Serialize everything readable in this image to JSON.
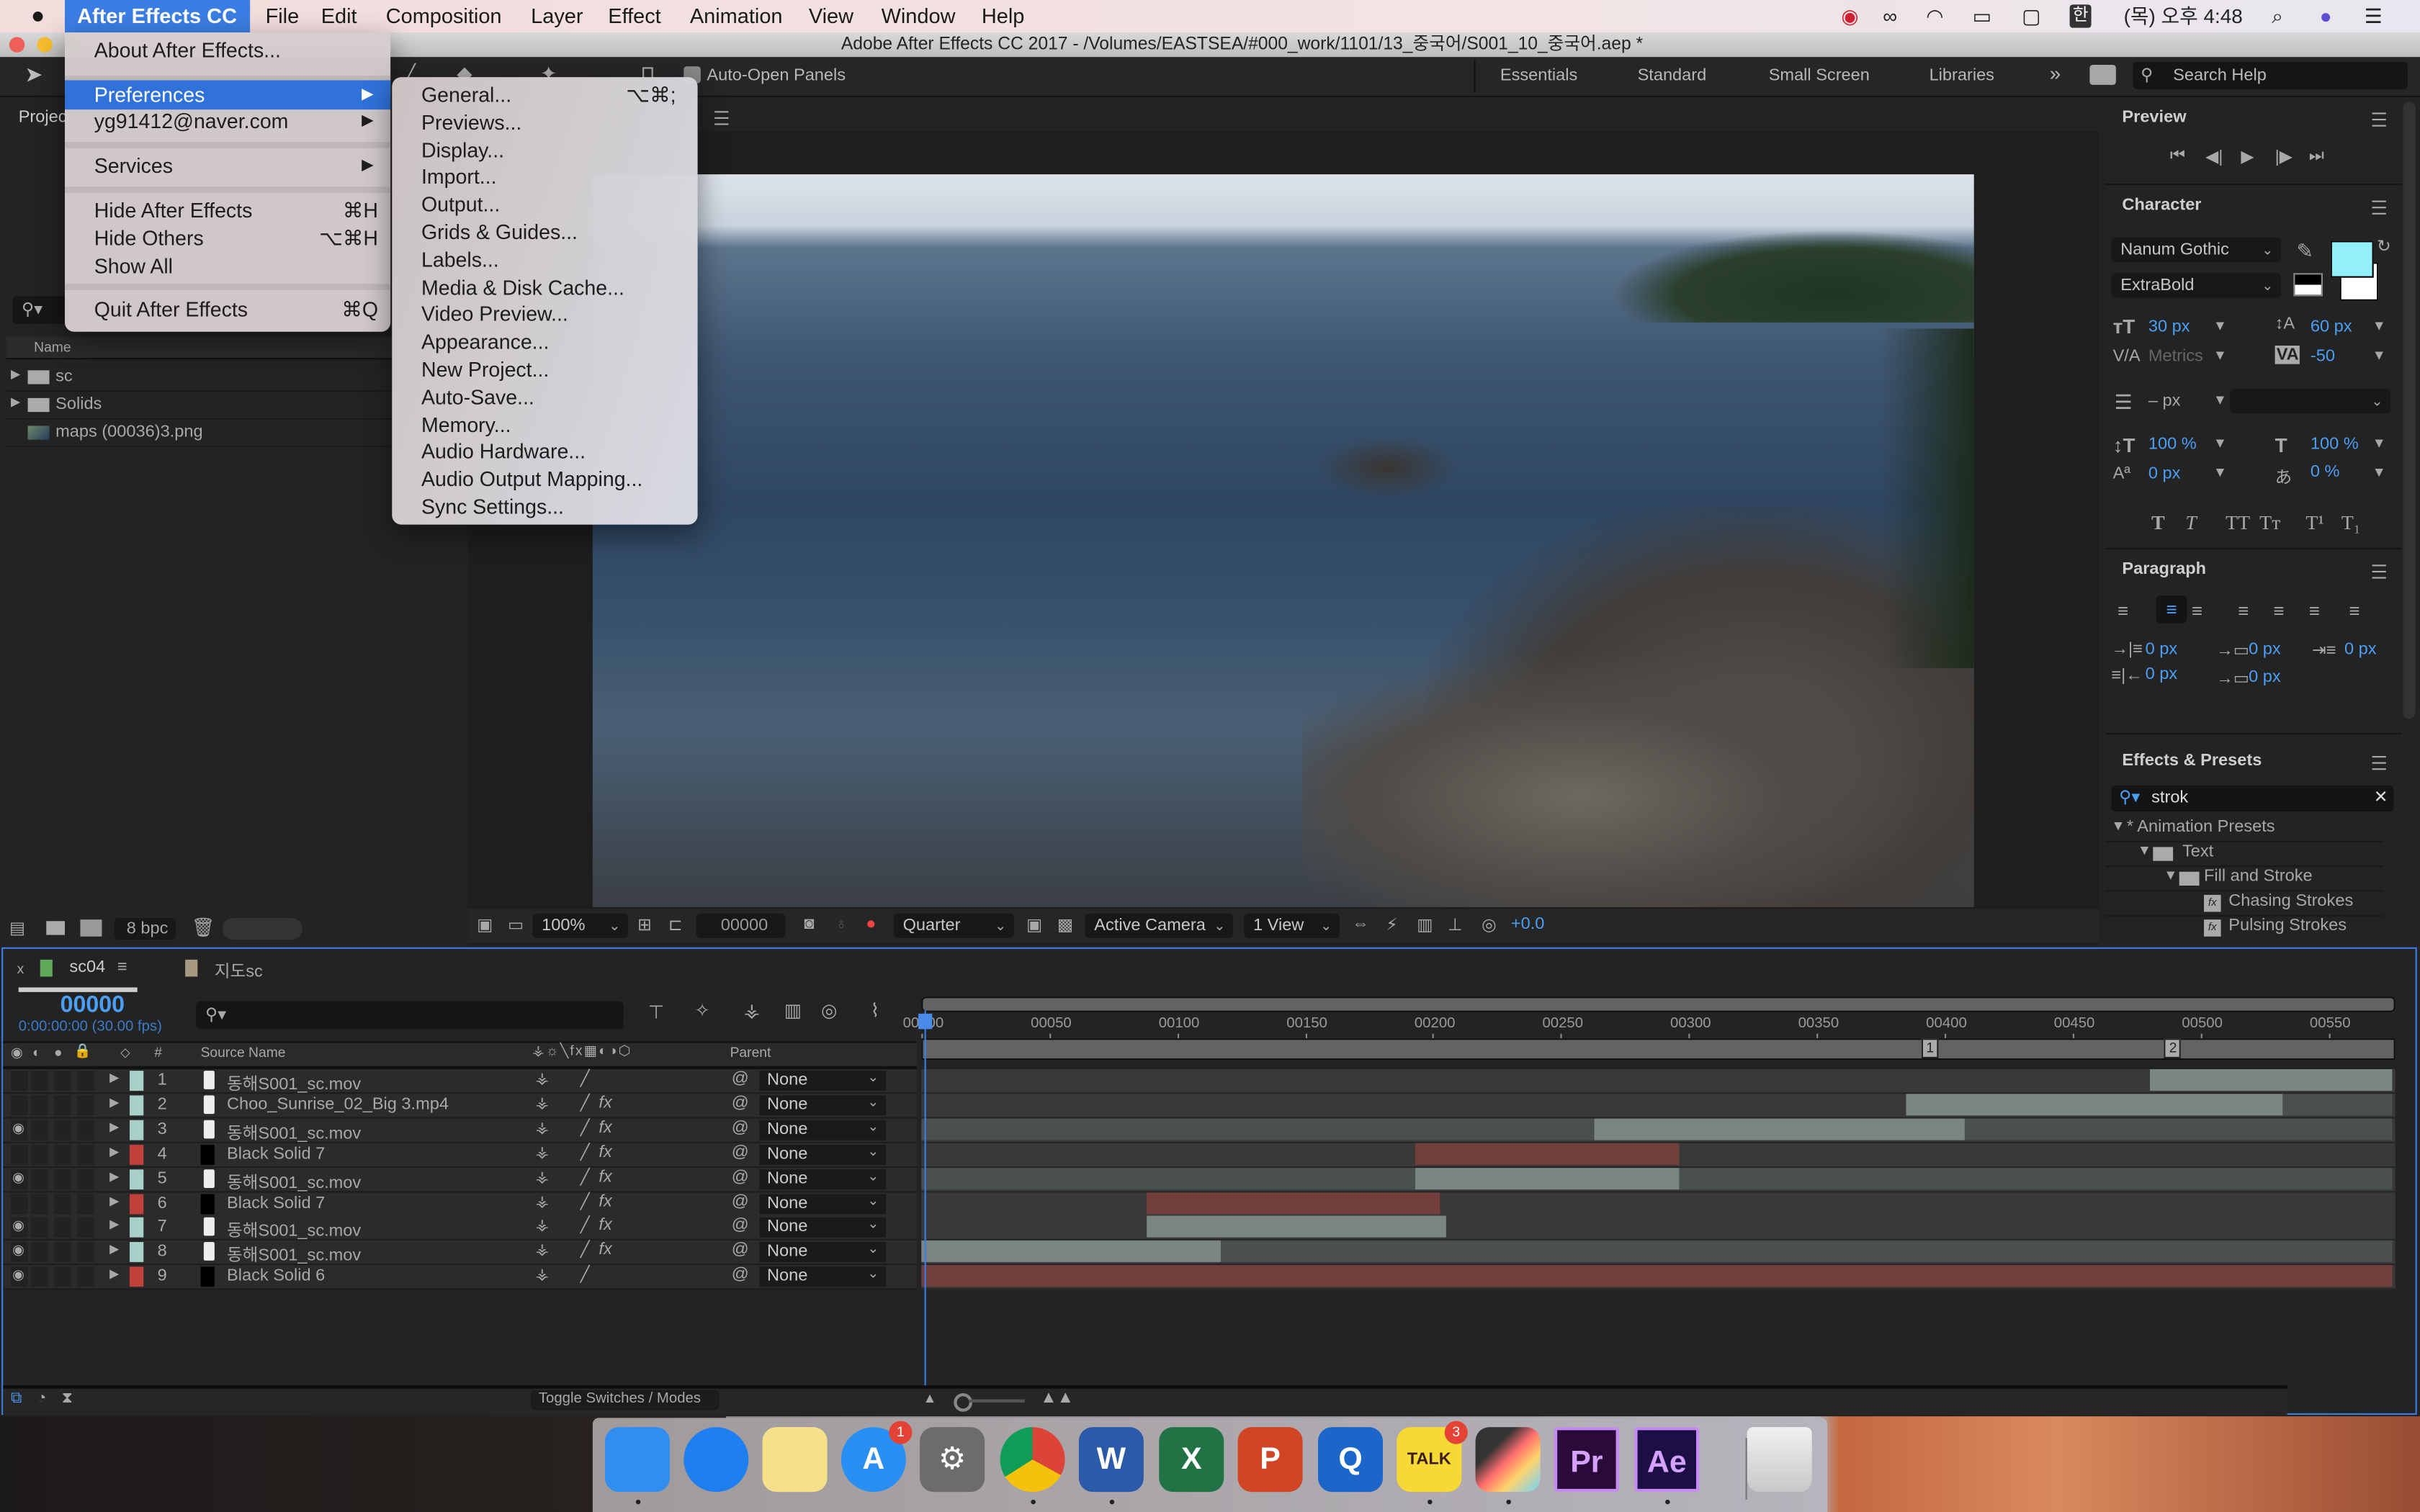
{
  "menubar": {
    "apple": "",
    "items": [
      "After Effects CC",
      "File",
      "Edit",
      "Composition",
      "Layer",
      "Effect",
      "Animation",
      "View",
      "Window",
      "Help"
    ],
    "active_index": 0,
    "input_method": "한",
    "clock": "(목) 오후 4:48"
  },
  "window": {
    "title": "Adobe After Effects CC 2017 - /Volumes/EASTSEA/#000_work/1101/13_중국어/S001_10_중국어.aep *"
  },
  "toolbar": {
    "auto_open_label": "Auto-Open Panels",
    "workspaces": [
      "Essentials",
      "Standard",
      "Small Screen",
      "Libraries"
    ],
    "more": "»",
    "search_placeholder": "Search Help"
  },
  "app_menu": {
    "items": [
      {
        "label": "About After Effects..."
      },
      {
        "label": "Preferences",
        "submenu": true,
        "selected": true
      },
      {
        "label": "yg91412@naver.com",
        "submenu": true
      },
      {
        "label": "Services",
        "submenu": true
      },
      {
        "label": "Hide After Effects",
        "shortcut": "⌘H"
      },
      {
        "label": "Hide Others",
        "shortcut": "⌥⌘H"
      },
      {
        "label": "Show All"
      },
      {
        "label": "Quit After Effects",
        "shortcut": "⌘Q"
      }
    ]
  },
  "prefs_menu": {
    "items": [
      {
        "label": "General...",
        "shortcut": "⌥⌘;"
      },
      {
        "label": "Previews..."
      },
      {
        "label": "Display..."
      },
      {
        "label": "Import..."
      },
      {
        "label": "Output..."
      },
      {
        "label": "Grids & Guides..."
      },
      {
        "label": "Labels..."
      },
      {
        "label": "Media & Disk Cache..."
      },
      {
        "label": "Video Preview..."
      },
      {
        "label": "Appearance..."
      },
      {
        "label": "New Project..."
      },
      {
        "label": "Auto-Save..."
      },
      {
        "label": "Memory..."
      },
      {
        "label": "Audio Hardware..."
      },
      {
        "label": "Audio Output Mapping..."
      },
      {
        "label": "Sync Settings..."
      }
    ]
  },
  "project": {
    "tab": "Projec",
    "column_name": "Name",
    "items": [
      {
        "name": "sc",
        "type": "folder"
      },
      {
        "name": "Solids",
        "type": "folder"
      },
      {
        "name": "maps (00036)3.png",
        "type": "image"
      }
    ],
    "bpc": "8 bpc"
  },
  "viewer": {
    "zoom": "100%",
    "timecode": "00000",
    "resolution": "Quarter",
    "camera": "Active Camera",
    "views": "1 View",
    "exposure": "+0.0"
  },
  "preview_panel": {
    "title": "Preview"
  },
  "character": {
    "title": "Character",
    "font": "Nanum Gothic",
    "style": "ExtraBold",
    "fill_color": "#93f0fb",
    "size": "30 px",
    "leading": "60 px",
    "kerning": "Metrics",
    "tracking": "-50",
    "stroke_width": "– px",
    "vert_scale": "100 %",
    "horiz_scale": "100 %",
    "baseline": "0 px",
    "tsume": "0 %",
    "styles": [
      "T",
      "T",
      "TT",
      "Tт",
      "T¹",
      "T₁"
    ]
  },
  "paragraph": {
    "title": "Paragraph",
    "indent_left": "0 px",
    "indent_first": "0 px",
    "indent_right": "0 px",
    "space_before": "0 px",
    "space_after": "0 px",
    "active_align": 1
  },
  "effects": {
    "title": "Effects & Presets",
    "search_value": "strok",
    "tree": [
      {
        "label": "* Animation Presets",
        "level": 0,
        "type": "group"
      },
      {
        "label": "Text",
        "level": 1,
        "type": "folder"
      },
      {
        "label": "Fill and Stroke",
        "level": 2,
        "type": "folder"
      },
      {
        "label": "Chasing Strokes",
        "level": 3,
        "type": "preset"
      },
      {
        "label": "Pulsing Strokes",
        "level": 3,
        "type": "preset"
      }
    ]
  },
  "timeline": {
    "tabs": [
      {
        "label": "sc04",
        "color": "#5fa85a",
        "active": true
      },
      {
        "label": "지도sc",
        "color": "#a89a80",
        "active": false
      }
    ],
    "timecode": "00000",
    "timecode_sub": "0:00:00:00 (30.00 fps)",
    "headers": {
      "num": "#",
      "source": "Source Name",
      "parent": "Parent"
    },
    "ruler_labels": [
      "00000",
      "00050",
      "00100",
      "00150",
      "00200",
      "00250",
      "00300",
      "00350",
      "00400",
      "00450",
      "00500",
      "00550"
    ],
    "ruler_max": 575,
    "markers": [
      "1",
      "2"
    ],
    "marker_frames": [
      391,
      486
    ],
    "layers": [
      {
        "num": "1",
        "name": "동해S001_sc.mov",
        "label": "#a9cfc9",
        "type": "movie",
        "visible": false,
        "fx": false,
        "parent": "None",
        "in": 480,
        "out": 575
      },
      {
        "num": "2",
        "name": "Choo_Sunrise_02_Big 3.mp4",
        "label": "#a9cfc9",
        "type": "movie",
        "visible": false,
        "fx": true,
        "parent": "None",
        "in": 385,
        "out": 532,
        "tail": true
      },
      {
        "num": "3",
        "name": "동해S001_sc.mov",
        "label": "#a9cfc9",
        "type": "movie",
        "visible": true,
        "fx": true,
        "parent": "None",
        "in": 263,
        "out": 408,
        "full": true
      },
      {
        "num": "4",
        "name": "Black Solid 7",
        "label": "#c0413c",
        "type": "solid",
        "visible": false,
        "fx": true,
        "parent": "None",
        "in": 193,
        "out": 296
      },
      {
        "num": "5",
        "name": "동해S001_sc.mov",
        "label": "#a9cfc9",
        "type": "movie",
        "visible": true,
        "fx": true,
        "parent": "None",
        "in": 193,
        "out": 296,
        "full": true
      },
      {
        "num": "6",
        "name": "Black Solid 7",
        "label": "#c0413c",
        "type": "solid",
        "visible": false,
        "fx": true,
        "parent": "None",
        "in": 88,
        "out": 203
      },
      {
        "num": "7",
        "name": "동해S001_sc.mov",
        "label": "#a9cfc9",
        "type": "movie",
        "visible": true,
        "fx": true,
        "parent": "None",
        "in": 88,
        "out": 205
      },
      {
        "num": "8",
        "name": "동해S001_sc.mov",
        "label": "#a9cfc9",
        "type": "movie",
        "visible": true,
        "fx": true,
        "parent": "None",
        "in": 0,
        "out": 117,
        "full": true
      },
      {
        "num": "9",
        "name": "Black Solid 6",
        "label": "#c0413c",
        "type": "solid",
        "visible": true,
        "fx": false,
        "parent": "None",
        "in": 0,
        "out": 575
      }
    ],
    "toggle_label": "Toggle Switches / Modes"
  },
  "dock": {
    "apps": [
      {
        "name": "Finder",
        "label": "",
        "color": "#2f8ef0",
        "running": true
      },
      {
        "name": "Safari",
        "label": "",
        "color": "#1e7ff0",
        "running": false
      },
      {
        "name": "Notes",
        "label": "",
        "color": "#f7e08a",
        "running": false
      },
      {
        "name": "App Store",
        "label": "A",
        "color": "#2a8ff2",
        "badge": "1",
        "running": false
      },
      {
        "name": "System Preferences",
        "label": "⚙",
        "color": "#6c6c6c",
        "running": false
      },
      {
        "name": "Chrome",
        "label": "",
        "color": "#dd4b39",
        "running": true
      },
      {
        "name": "Word",
        "label": "W",
        "color": "#2b5aa9",
        "running": true
      },
      {
        "name": "Excel",
        "label": "X",
        "color": "#217346",
        "running": false
      },
      {
        "name": "PowerPoint",
        "label": "P",
        "color": "#d14424",
        "running": false
      },
      {
        "name": "QuickTime",
        "label": "Q",
        "color": "#1d66c9",
        "running": false
      },
      {
        "name": "KakaoTalk",
        "label": "TALK",
        "color": "#f7d936",
        "badge": "3",
        "running": true
      },
      {
        "name": "Final Cut Pro",
        "label": "",
        "color": "#3a3a3a",
        "running": true
      },
      {
        "name": "Premiere Pro",
        "label": "Pr",
        "color": "#2a0a38",
        "running": false
      },
      {
        "name": "After Effects",
        "label": "Ae",
        "color": "#1b0f45",
        "running": true
      },
      {
        "name": "Trash",
        "label": "",
        "color": "#d9d9d9",
        "running": false
      }
    ]
  }
}
